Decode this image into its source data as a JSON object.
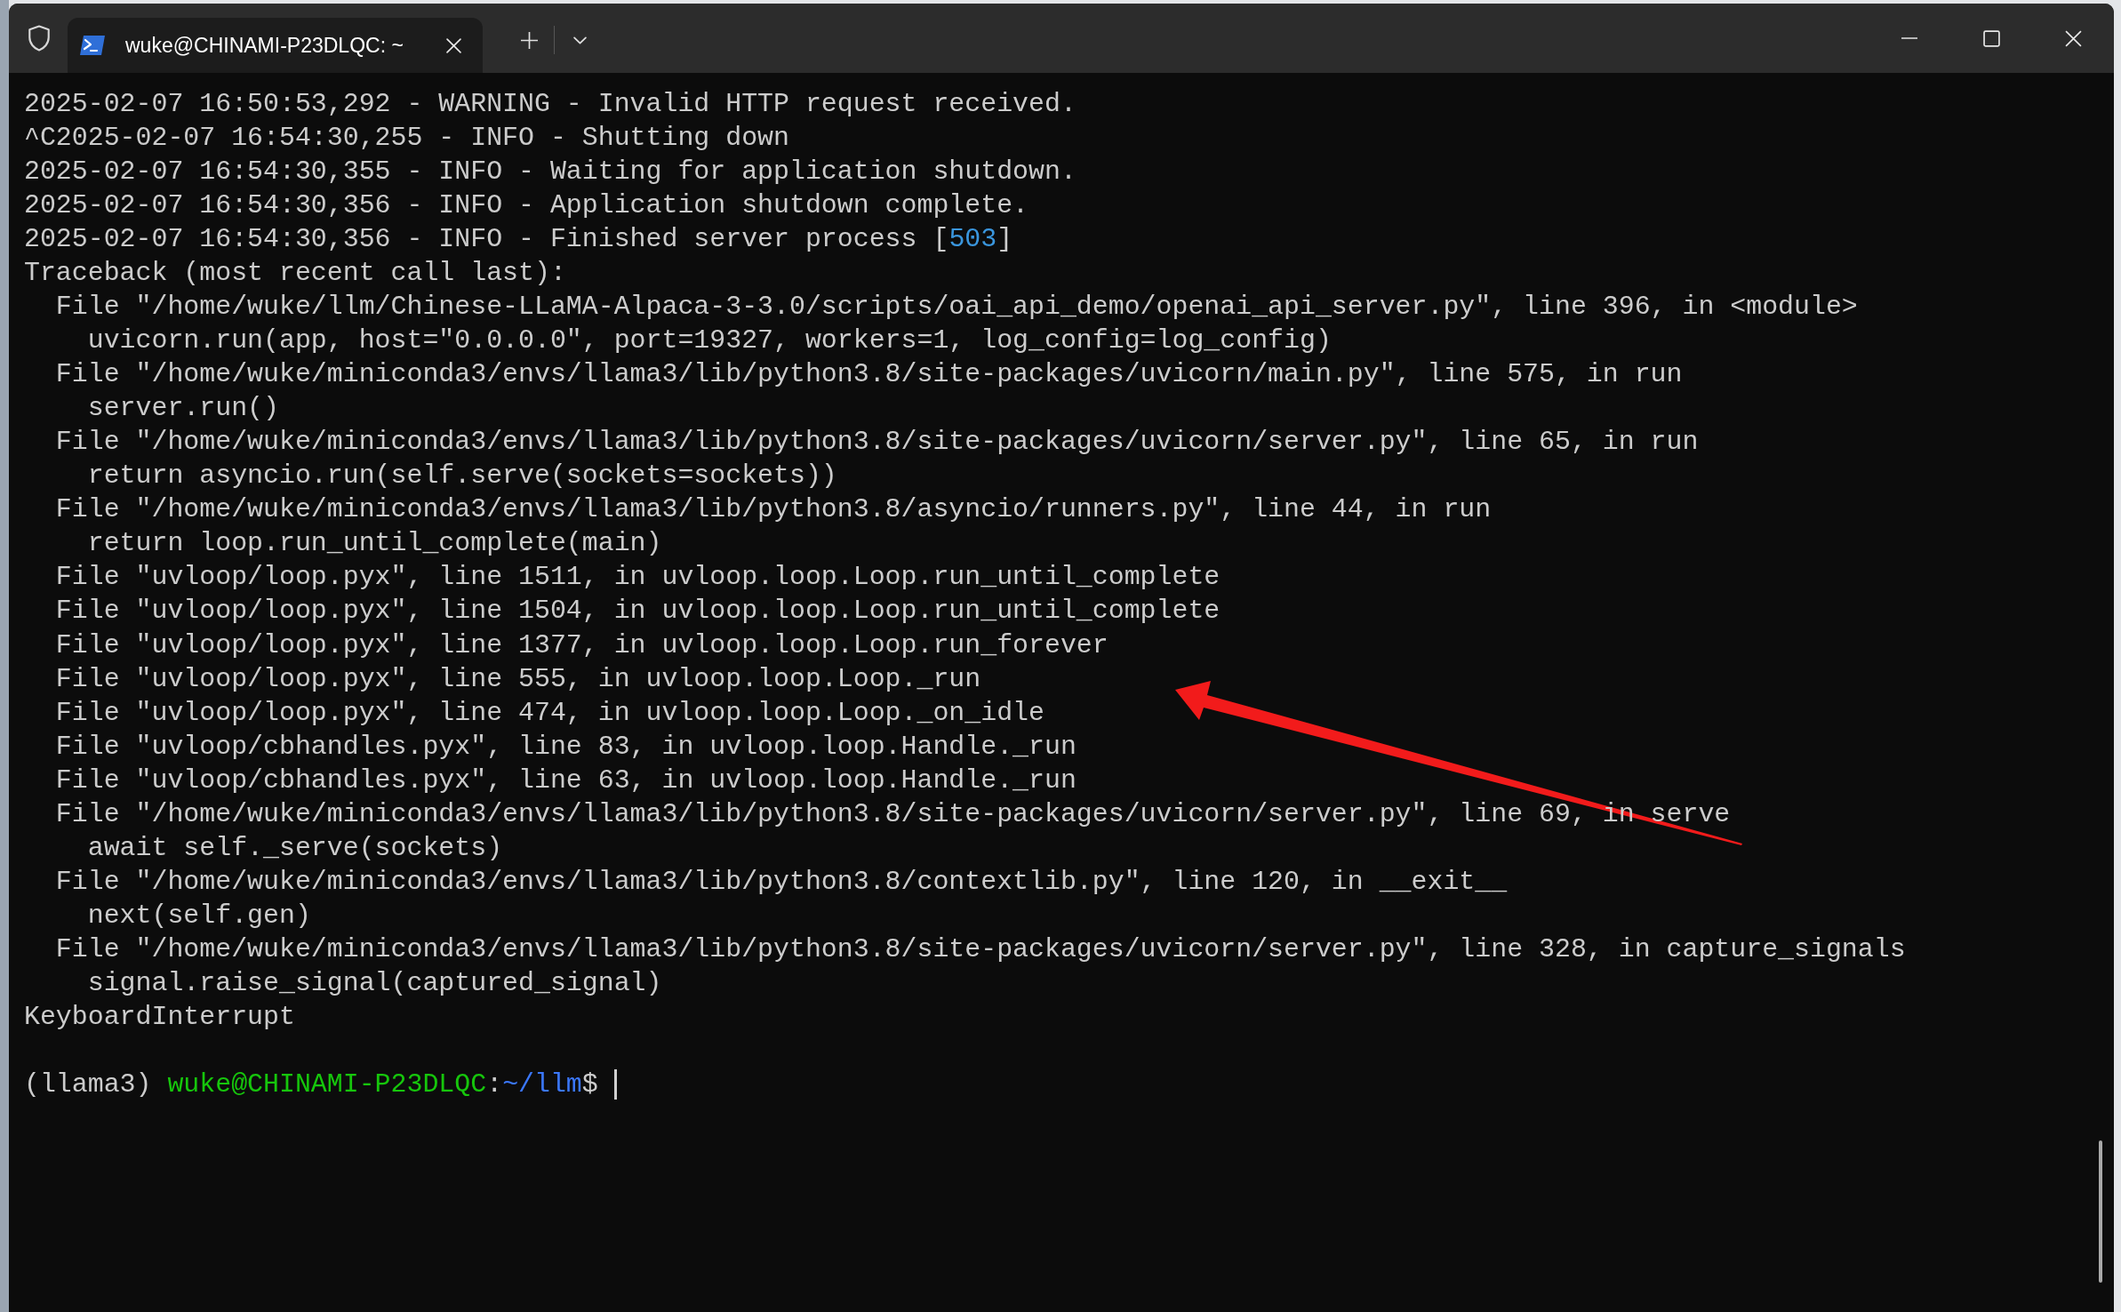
{
  "tabs": [
    {
      "title": "wuke@CHINAMI-P23DLQC: ~",
      "selected": true
    }
  ],
  "lines": [
    {
      "segments": [
        {
          "kind": "plain",
          "text": "2025-02-07 16:50:53,292 - WARNING - Invalid HTTP request received."
        }
      ]
    },
    {
      "segments": [
        {
          "kind": "plain",
          "text": "^C2025-02-07 16:54:30,255 - INFO - Shutting down"
        }
      ]
    },
    {
      "segments": [
        {
          "kind": "plain",
          "text": "2025-02-07 16:54:30,355 - INFO - Waiting for application shutdown."
        }
      ]
    },
    {
      "segments": [
        {
          "kind": "plain",
          "text": "2025-02-07 16:54:30,356 - INFO - Application shutdown complete."
        }
      ]
    },
    {
      "segments": [
        {
          "kind": "plain",
          "text": "2025-02-07 16:54:30,356 - INFO - Finished server process ["
        },
        {
          "kind": "number",
          "text": "503"
        },
        {
          "kind": "plain",
          "text": "]"
        }
      ]
    },
    {
      "segments": [
        {
          "kind": "plain",
          "text": "Traceback (most recent call last):"
        }
      ]
    },
    {
      "segments": [
        {
          "kind": "plain",
          "text": "  File \"/home/wuke/llm/Chinese-LLaMA-Alpaca-3-3.0/scripts/oai_api_demo/openai_api_server.py\", line 396, in <module>"
        }
      ]
    },
    {
      "segments": [
        {
          "kind": "plain",
          "text": "    uvicorn.run(app, host=\"0.0.0.0\", port=19327, workers=1, log_config=log_config)"
        }
      ]
    },
    {
      "segments": [
        {
          "kind": "plain",
          "text": "  File \"/home/wuke/miniconda3/envs/llama3/lib/python3.8/site-packages/uvicorn/main.py\", line 575, in run"
        }
      ]
    },
    {
      "segments": [
        {
          "kind": "plain",
          "text": "    server.run()"
        }
      ]
    },
    {
      "segments": [
        {
          "kind": "plain",
          "text": "  File \"/home/wuke/miniconda3/envs/llama3/lib/python3.8/site-packages/uvicorn/server.py\", line 65, in run"
        }
      ]
    },
    {
      "segments": [
        {
          "kind": "plain",
          "text": "    return asyncio.run(self.serve(sockets=sockets))"
        }
      ]
    },
    {
      "segments": [
        {
          "kind": "plain",
          "text": "  File \"/home/wuke/miniconda3/envs/llama3/lib/python3.8/asyncio/runners.py\", line 44, in run"
        }
      ]
    },
    {
      "segments": [
        {
          "kind": "plain",
          "text": "    return loop.run_until_complete(main)"
        }
      ]
    },
    {
      "segments": [
        {
          "kind": "plain",
          "text": "  File \"uvloop/loop.pyx\", line 1511, in uvloop.loop.Loop.run_until_complete"
        }
      ]
    },
    {
      "segments": [
        {
          "kind": "plain",
          "text": "  File \"uvloop/loop.pyx\", line 1504, in uvloop.loop.Loop.run_until_complete"
        }
      ]
    },
    {
      "segments": [
        {
          "kind": "plain",
          "text": "  File \"uvloop/loop.pyx\", line 1377, in uvloop.loop.Loop.run_forever"
        }
      ]
    },
    {
      "segments": [
        {
          "kind": "plain",
          "text": "  File \"uvloop/loop.pyx\", line 555, in uvloop.loop.Loop._run"
        }
      ]
    },
    {
      "segments": [
        {
          "kind": "plain",
          "text": "  File \"uvloop/loop.pyx\", line 474, in uvloop.loop.Loop._on_idle"
        }
      ]
    },
    {
      "segments": [
        {
          "kind": "plain",
          "text": "  File \"uvloop/cbhandles.pyx\", line 83, in uvloop.loop.Handle._run"
        }
      ]
    },
    {
      "segments": [
        {
          "kind": "plain",
          "text": "  File \"uvloop/cbhandles.pyx\", line 63, in uvloop.loop.Handle._run"
        }
      ]
    },
    {
      "segments": [
        {
          "kind": "plain",
          "text": "  File \"/home/wuke/miniconda3/envs/llama3/lib/python3.8/site-packages/uvicorn/server.py\", line 69, in serve"
        }
      ]
    },
    {
      "segments": [
        {
          "kind": "plain",
          "text": "    await self._serve(sockets)"
        }
      ]
    },
    {
      "segments": [
        {
          "kind": "plain",
          "text": "  File \"/home/wuke/miniconda3/envs/llama3/lib/python3.8/contextlib.py\", line 120, in __exit__"
        }
      ]
    },
    {
      "segments": [
        {
          "kind": "plain",
          "text": "    next(self.gen)"
        }
      ]
    },
    {
      "segments": [
        {
          "kind": "plain",
          "text": "  File \"/home/wuke/miniconda3/envs/llama3/lib/python3.8/site-packages/uvicorn/server.py\", line 328, in capture_signals"
        }
      ]
    },
    {
      "segments": [
        {
          "kind": "plain",
          "text": "    signal.raise_signal(captured_signal)"
        }
      ]
    },
    {
      "segments": [
        {
          "kind": "plain",
          "text": "KeyboardInterrupt"
        }
      ]
    }
  ],
  "prompt": {
    "segments": [
      {
        "kind": "plain",
        "text": "(llama3) "
      },
      {
        "kind": "user_host",
        "text": "wuke@CHINAMI-P23DLQC"
      },
      {
        "kind": "plain",
        "text": ":"
      },
      {
        "kind": "path",
        "text": "~/llm"
      },
      {
        "kind": "plain",
        "text": "$"
      }
    ],
    "cursor": true
  },
  "annotations": [
    {
      "kind": "arrow"
    }
  ]
}
